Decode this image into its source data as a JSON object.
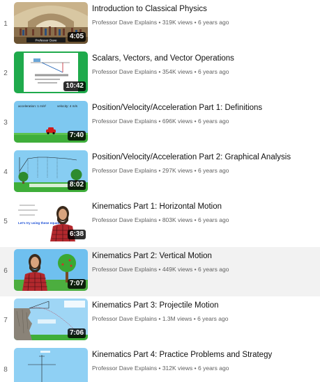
{
  "playlist": {
    "items": [
      {
        "index": "1",
        "title": "Introduction to Classical Physics",
        "channel": "Professor Dave Explains",
        "views": "319K views",
        "age": "6 years ago",
        "duration": "4:05"
      },
      {
        "index": "2",
        "title": "Scalars, Vectors, and Vector Operations",
        "channel": "Professor Dave Explains",
        "views": "354K views",
        "age": "6 years ago",
        "duration": "10:42"
      },
      {
        "index": "3",
        "title": "Position/Velocity/Acceleration Part 1: Definitions",
        "channel": "Professor Dave Explains",
        "views": "696K views",
        "age": "6 years ago",
        "duration": "7:40"
      },
      {
        "index": "4",
        "title": "Position/Velocity/Acceleration Part 2: Graphical Analysis",
        "channel": "Professor Dave Explains",
        "views": "297K views",
        "age": "6 years ago",
        "duration": "8:02"
      },
      {
        "index": "5",
        "title": "Kinematics Part 1: Horizontal Motion",
        "channel": "Professor Dave Explains",
        "views": "803K views",
        "age": "6 years ago",
        "duration": "6:38"
      },
      {
        "index": "6",
        "title": "Kinematics Part 2: Vertical Motion",
        "channel": "Professor Dave Explains",
        "views": "449K views",
        "age": "6 years ago",
        "duration": "7:07"
      },
      {
        "index": "7",
        "title": "Kinematics Part 3: Projectile Motion",
        "channel": "Professor Dave Explains",
        "views": "1.3M views",
        "age": "6 years ago",
        "duration": "7:06"
      },
      {
        "index": "8",
        "title": "Kinematics Part 4: Practice Problems and Strategy",
        "channel": "Professor Dave Explains",
        "views": "312K views",
        "age": "6 years ago",
        "duration": ""
      }
    ],
    "separator": "•",
    "thumb_text": {
      "t1_banner": "Professor Dave",
      "t3_accel": "acceleration: 1 m/s²",
      "t3_vel": "velocity: 4 m/s",
      "t5_equations": "Let's try using these equations!"
    }
  }
}
